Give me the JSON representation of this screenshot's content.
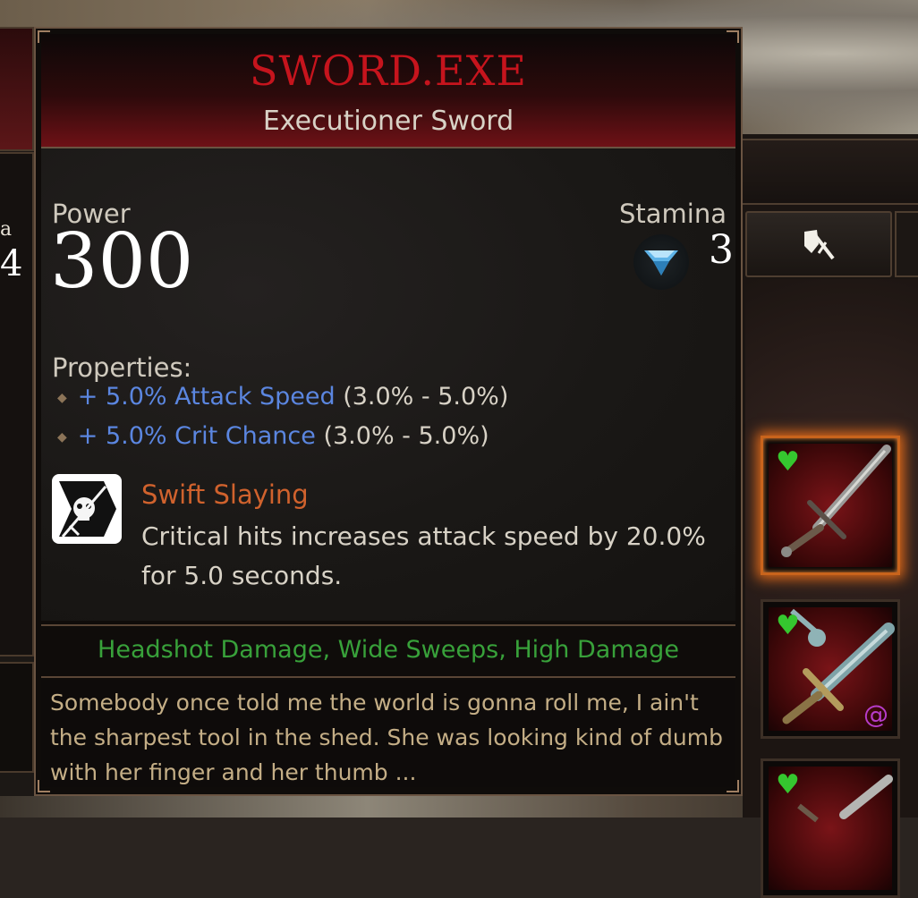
{
  "tooltip": {
    "item_name": "SWORD.EXE",
    "item_type": "Executioner Sword",
    "power_label": "Power",
    "power_value": "300",
    "stamina_label": "Stamina",
    "stamina_value": "3",
    "stamina_icon": "stamina-drop-icon",
    "properties_label": "Properties:",
    "properties": [
      {
        "stat": "+ 5.0% Attack Speed",
        "range": "(3.0% - 5.0%)"
      },
      {
        "stat": "+ 5.0% Crit Chance",
        "range": "(3.0% - 5.0%)"
      }
    ],
    "perk": {
      "icon": "skull-sword-icon",
      "name": "Swift Slaying",
      "description": "Critical hits increases attack speed by 20.0% for 5.0 seconds."
    },
    "tags": "Headshot Damage, Wide Sweeps, High Damage",
    "lore": "Somebody once told me the world is gonna roll me, I ain't the sharpest tool in the shed. She was looking kind of dumb with her finger and her thumb ..."
  },
  "left_fragment": {
    "line1": "a",
    "line2": "4"
  },
  "inventory": {
    "tab_icon": "sword-shield-icon",
    "slots": [
      {
        "icon": "sword-icon",
        "favorite": "heart-icon",
        "selected": true
      },
      {
        "icon": "ornate-sword-icon",
        "favorite": "heart-icon",
        "selected": false,
        "badge": "swirl-icon"
      },
      {
        "icon": "sword-icon",
        "favorite": "heart-icon",
        "selected": false
      }
    ]
  },
  "colors": {
    "item_name": "#c6141d",
    "stat_blue": "#5b86e0",
    "perk_orange": "#d0622d",
    "tags_green": "#38a13a",
    "lore_tan": "#c4ae86",
    "selected_glow": "#e06a1a",
    "favorite_green": "#35c72f"
  }
}
